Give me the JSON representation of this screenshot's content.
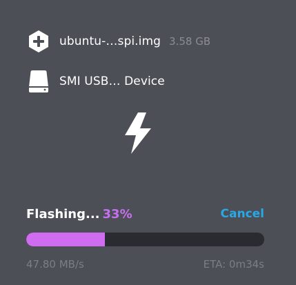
{
  "source": {
    "icon": "plus-hexagon-icon",
    "filename": "ubuntu-…spi.img",
    "size": "3.58 GB"
  },
  "target": {
    "icon": "drive-icon",
    "name": "SMI USB… Device"
  },
  "flash_icon": "lightning-bolt-icon",
  "status": {
    "label": "Flashing...",
    "percent_text": "33%",
    "progress": 0.33,
    "cancel_label": "Cancel",
    "speed": "47.80 MB/s",
    "eta": "ETA: 0m34s"
  },
  "colors": {
    "background": "#4d4f57",
    "accent_progress": "#cf6cf0",
    "percent": "#c86ef1",
    "cancel": "#2aa8e6",
    "track": "#2a2b30"
  }
}
